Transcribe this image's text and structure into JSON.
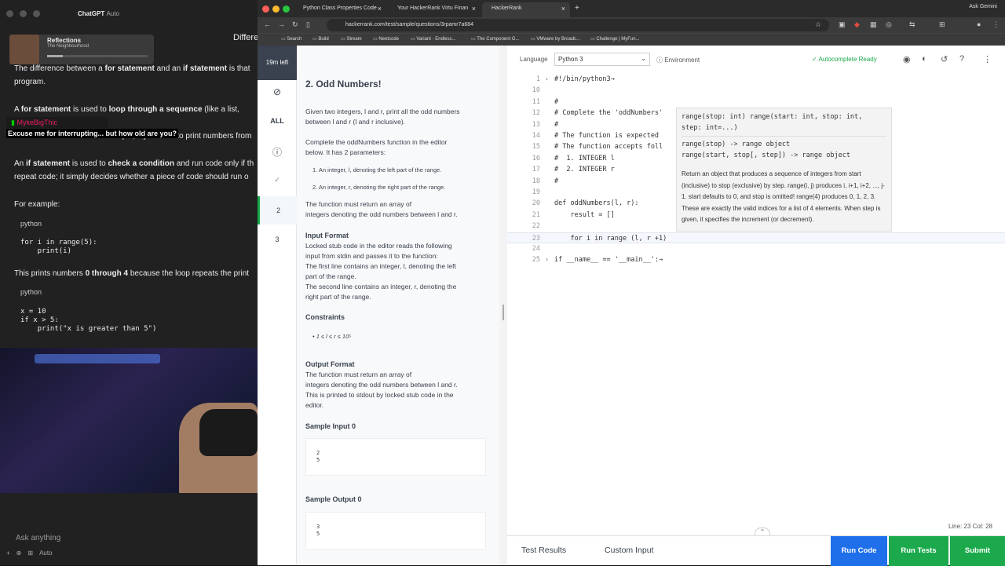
{
  "chatgpt": {
    "window_title": "ChatGPT",
    "model": "Auto",
    "header_right": "Differe",
    "now_playing": {
      "title": "Reflections",
      "artist": "The Neighbourhood"
    },
    "paragraphs": [
      {
        "pre": "The difference between a ",
        "b1": "for statement",
        "mid": " and an ",
        "b2": "if statement",
        "post": " is that",
        "line2": "program."
      },
      {
        "pre": "A ",
        "b1": "for statement",
        "mid": " is used to ",
        "b2": "loop through a sequence",
        "post": " (like a list, strin",
        "line2": ". For example, if you want to print numbers from"
      },
      {
        "pre": "An ",
        "b1": "if statement",
        "mid": " is used to ",
        "b2": "check a condition",
        "post": " and run code only if th",
        "line2": "repeat code; it simply decides whether a piece of code should run o"
      }
    ],
    "for_example": "For example:",
    "lang_python": "python",
    "code1": "for i in range(5):\n    print(i)",
    "prints_text_pre": "This prints numbers ",
    "prints_b1": "0 through 4",
    "prints_post": " because the loop repeats the print",
    "code2": "x = 10\nif x > 5:\n    print(\"x is greater than 5\")",
    "twitch_user": "MykeBigThic",
    "twitch_msg": "Excuse me for interrupting... but how old are you?",
    "ask_placeholder": "Ask anything",
    "ask_mode": "Auto"
  },
  "browser": {
    "tabs": [
      "Python Class Properties Code",
      "Your HackerRank Virtu Finan",
      "HackerRank"
    ],
    "new_tab": "+",
    "ask_gemini": "Ask Gemini",
    "url": "hackerrank.com/test/sample/questions/3rpamr7a684",
    "bookmarks": [
      "Search",
      "Build",
      "Stream",
      "Neetcode",
      "Variant - Endless...",
      "The Component G...",
      "VMware by Broadc...",
      "Challenge | MyFun..."
    ]
  },
  "rail": {
    "timer": "19m left",
    "items": [
      "ALL",
      "2",
      "3"
    ]
  },
  "problem": {
    "title": "2. Odd Numbers!",
    "intro1": "Given two integers, l and r, print all the odd numbers",
    "intro2": "between l and r (l and r inclusive).",
    "complete1": "Complete the oddNumbers function in the editor",
    "complete2": "below. It has 2 parameters:",
    "param1": "1. An integer, l, denoting the left part of the range.",
    "param2": "2. An integer, r, denoting the right part of the range.",
    "must1": "The function must return an array of",
    "must2": "integers denoting the odd numbers between l and r.",
    "input_format_h": "Input Format",
    "input_lines": [
      "Locked stub code in the editor reads the following",
      "input from stdin and passes it to the function:",
      "The first line contains an integer, l, denoting the left",
      "part of the range.",
      "The second line contains an integer, r, denoting the",
      "right part of the range."
    ],
    "constraints_h": "Constraints",
    "constraint": "1 ≤ l ≤ r ≤ 10⁵",
    "output_format_h": "Output Format",
    "output_lines": [
      "The function must return an array of",
      "integers denoting the odd numbers between l and r.",
      "This is printed to stdout by locked stub code in the",
      "editor."
    ],
    "sample_input_h": "Sample Input 0",
    "sample_input": "2\n5",
    "sample_output_h": "Sample Output 0",
    "sample_output": "3\n5"
  },
  "editor": {
    "language_label": "Language",
    "language": "Python 3",
    "environment": "Environment",
    "autocomplete": "Autocomplete Ready",
    "lines": [
      {
        "n": "1",
        "t": "#!/bin/python3→",
        "fold": true,
        "cls": "cmt"
      },
      {
        "n": "10",
        "t": "",
        "cls": ""
      },
      {
        "n": "11",
        "t": "#",
        "cls": "cmt"
      },
      {
        "n": "12",
        "t": "# Complete the 'oddNumbers'",
        "cls": "cmt"
      },
      {
        "n": "13",
        "t": "#",
        "cls": "cmt"
      },
      {
        "n": "14",
        "t": "# The function is expected",
        "cls": "cmt"
      },
      {
        "n": "15",
        "t": "# The function accepts foll",
        "cls": "cmt"
      },
      {
        "n": "16",
        "t": "#  1. INTEGER l",
        "cls": "cmt"
      },
      {
        "n": "17",
        "t": "#  2. INTEGER r",
        "cls": "cmt"
      },
      {
        "n": "18",
        "t": "#",
        "cls": "cmt"
      },
      {
        "n": "19",
        "t": "",
        "cls": ""
      },
      {
        "n": "20",
        "t": "def oddNumbers(l, r):",
        "cls": ""
      },
      {
        "n": "21",
        "t": "    result = []",
        "cls": ""
      },
      {
        "n": "22",
        "t": "",
        "cls": ""
      },
      {
        "n": "23",
        "t": "    for i in range (l, r +1)",
        "cls": "",
        "cur": true
      },
      {
        "n": "24",
        "t": "",
        "cls": ""
      },
      {
        "n": "25",
        "t": "if __name__ == '__main__':→",
        "fold": true,
        "cls": "kw"
      }
    ],
    "tooltip": {
      "sig1": "range(stop: int) range(start: int, stop: int,",
      "sig2": "step: int=...)",
      "ret1": "range(stop) -> range object",
      "ret2": "range(start, stop[, step]) -> range object",
      "doc": "Return an object that produces a sequence of integers from start (inclusive) to stop (exclusive) by step. range(i, j) produces i, i+1, i+2, ..., j-1. start defaults to 0, and stop is omitted! range(4) produces 0, 1, 2, 3. These are exactly the valid indices for a list of 4 elements. When step is given, it specifies the increment (or decrement)."
    },
    "cursor_pos": "Line: 23 Col: 28",
    "bottom_tabs": [
      "Test Results",
      "Custom Input"
    ],
    "buttons": {
      "run_code": "Run Code",
      "run_tests": "Run Tests",
      "submit": "Submit"
    }
  },
  "colors": {
    "accent_green": "#1ba94c",
    "run_code_blue": "#1f6feb",
    "dark_nav": "#39424e"
  }
}
